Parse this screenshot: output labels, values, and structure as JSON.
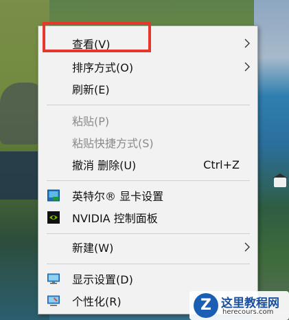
{
  "menu": {
    "items": [
      {
        "label": "查看(V)",
        "has_submenu": true
      },
      {
        "label": "排序方式(O)",
        "has_submenu": true
      },
      {
        "label": "刷新(E)"
      },
      {
        "label": "粘贴(P)",
        "disabled": true
      },
      {
        "label": "粘贴快捷方式(S)",
        "disabled": true
      },
      {
        "label": "撤消 删除(U)",
        "shortcut": "Ctrl+Z"
      },
      {
        "label": "英特尔® 显卡设置",
        "icon": "intel-graphics-icon"
      },
      {
        "label": "NVIDIA 控制面板",
        "icon": "nvidia-icon"
      },
      {
        "label": "新建(W)",
        "has_submenu": true
      },
      {
        "label": "显示设置(D)",
        "icon": "monitor-icon"
      },
      {
        "label": "个性化(R)",
        "icon": "personalize-icon"
      }
    ]
  },
  "watermark": {
    "title": "这里教程网",
    "url": "herecours.com",
    "letter": "Z"
  },
  "colors": {
    "highlight": "#e7372c",
    "menu_bg": "#f2f2f2",
    "disabled_text": "#8a8a8a"
  }
}
